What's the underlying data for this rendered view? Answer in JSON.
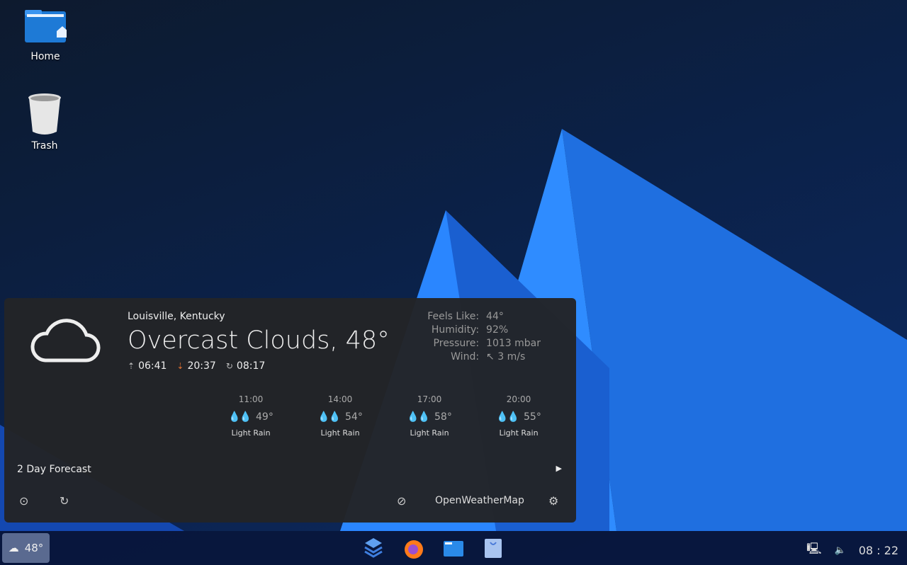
{
  "desktop": {
    "icons": [
      {
        "label": "Home"
      },
      {
        "label": "Trash"
      }
    ]
  },
  "weather": {
    "location": "Louisville, Kentucky",
    "condition": "Overcast Clouds, 48°",
    "sunrise": "06:41",
    "sunset": "20:37",
    "updated": "08:17",
    "details": [
      {
        "k": "Feels Like:",
        "v": "44°"
      },
      {
        "k": "Humidity:",
        "v": "92%"
      },
      {
        "k": "Pressure:",
        "v": "1013 mbar"
      },
      {
        "k": "Wind:",
        "v": "↖ 3 m/s"
      }
    ],
    "hourly": [
      {
        "time": "11:00",
        "temp": "49°",
        "cond": "Light Rain"
      },
      {
        "time": "14:00",
        "temp": "54°",
        "cond": "Light Rain"
      },
      {
        "time": "17:00",
        "temp": "58°",
        "cond": "Light Rain"
      },
      {
        "time": "20:00",
        "temp": "55°",
        "cond": "Light Rain"
      }
    ],
    "forecast_label": "2 Day Forecast",
    "provider": "OpenWeatherMap"
  },
  "taskbar": {
    "weather_temp": "48°",
    "clock": "08 : 22"
  }
}
